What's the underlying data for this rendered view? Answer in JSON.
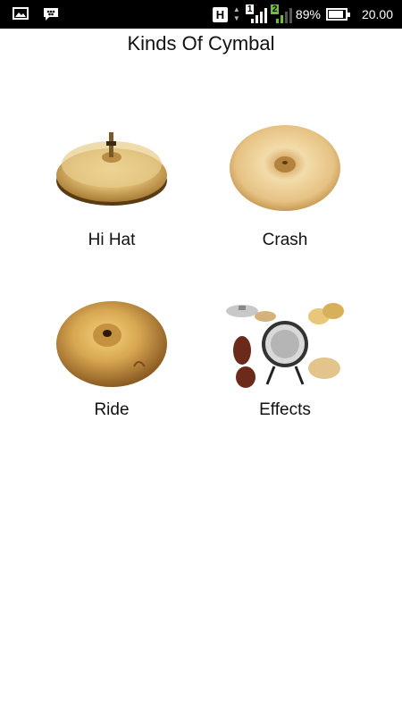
{
  "status_bar": {
    "battery_percent": "89%",
    "battery_level": 0.89,
    "time": "20.00",
    "network_badge": "H",
    "sim1_label": "1",
    "sim2_label": "2",
    "icons": [
      "gallery-icon",
      "bbm-icon",
      "signal-icon",
      "battery-icon"
    ]
  },
  "title": "Kinds Of Cymbal",
  "items": [
    {
      "label": "Hi Hat"
    },
    {
      "label": "Crash"
    },
    {
      "label": "Ride"
    },
    {
      "label": "Effects"
    }
  ],
  "colors": {
    "cymbal_gold": "#d9b46a",
    "cymbal_light": "#f2dfae",
    "cymbal_dark": "#8a6324",
    "background": "#ffffff"
  }
}
